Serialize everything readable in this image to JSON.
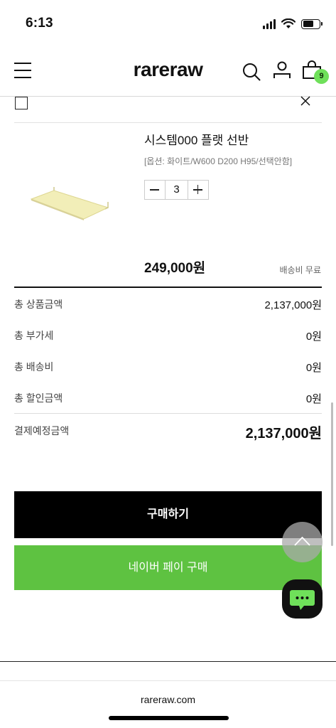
{
  "status_bar": {
    "time": "6:13"
  },
  "header": {
    "logo": "rareraw",
    "cart_count": "9"
  },
  "product": {
    "name": "시스템000 플랫 선반",
    "option": "[옵션: 화이트/W600 D200 H95/선택안함]",
    "quantity": "3",
    "price": "249,000원",
    "shipping_note": "배송비 무료"
  },
  "summary": {
    "rows": [
      {
        "label": "총 상품금액",
        "value": "2,137,000원"
      },
      {
        "label": "총 부가세",
        "value": "0원"
      },
      {
        "label": "총 배송비",
        "value": "0원"
      },
      {
        "label": "총 할인금액",
        "value": "0원"
      }
    ],
    "total_label": "결제예정금액",
    "total_value": "2,137,000원"
  },
  "actions": {
    "buy_label": "구매하기",
    "naver_pay_label": "네이버 페이 구매"
  },
  "browser": {
    "url": "rareraw.com"
  },
  "colors": {
    "naver_green": "#5ec241",
    "badge_green": "#6fe05a",
    "chat_icon": "#6fe05a"
  }
}
